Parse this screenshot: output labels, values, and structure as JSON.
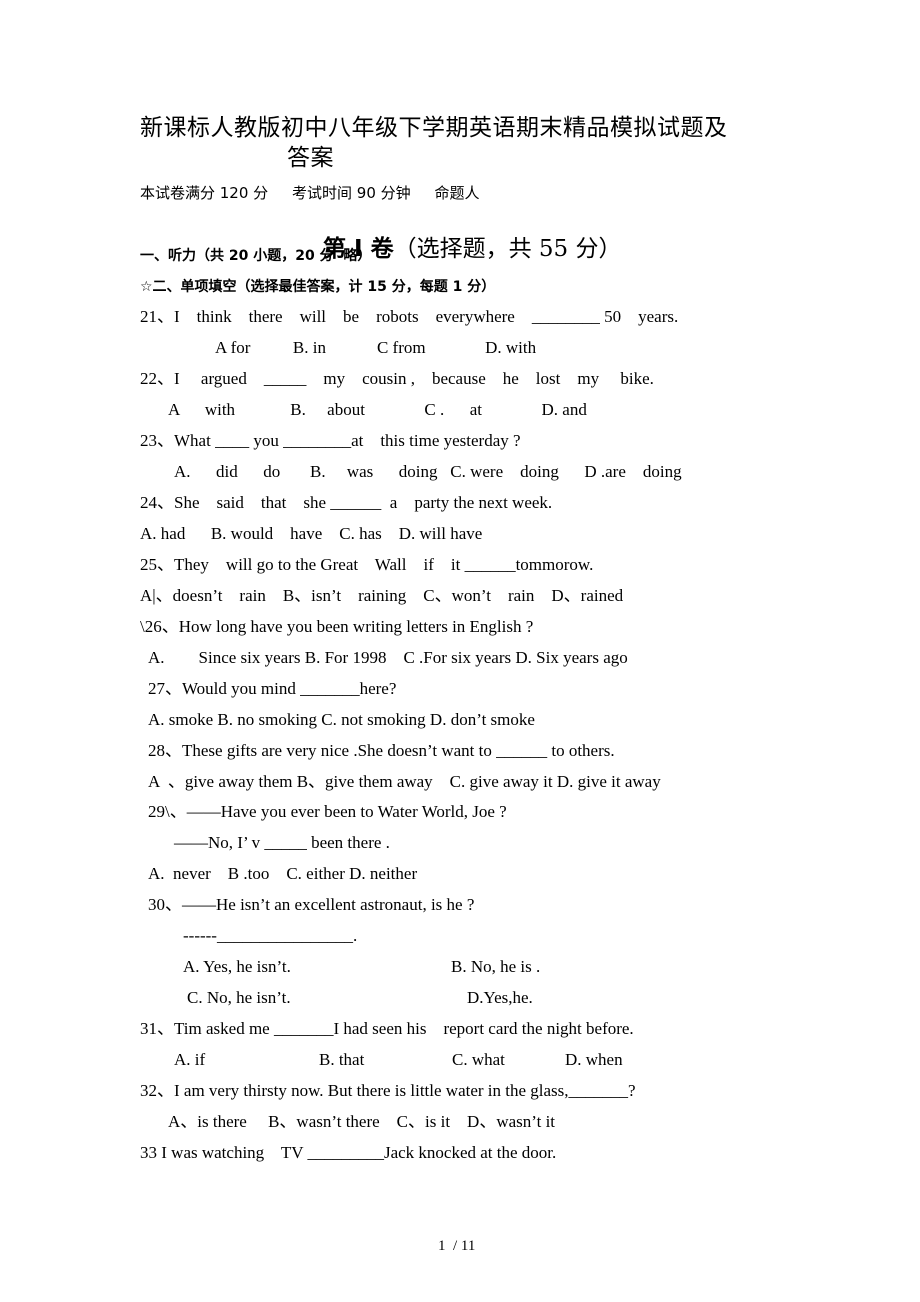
{
  "document": {
    "title_line1": "新课标人教版初中八年级下学期英语期末精品模拟试题及",
    "title_line2": "答案",
    "meta": "本试卷满分 120 分     考试时间 90 分钟     命题人",
    "part_bold": "第 I 卷",
    "part_rest": "（选择题，共 55 分）",
    "section1": "一、听力（共 20 小题，20 分  略）",
    "section2": "☆二、单项填空（选择最佳答案，计 15 分，每题 1 分）"
  },
  "lines": [
    "21、I    think    there    will    be    robots    everywhere    ________ 50    years.",
    "A for          B. in            C from              D. with",
    "22、I     argued    _____    my    cousin ,    because    he    lost    my     bike.",
    "A      with             B.     about              C .      at              D. and",
    "23、What ____ you ________at    this time yesterday ?",
    "A.      did      do       B.     was      doing   C. were    doing      D .are    doing",
    "24、She    said    that    she ______  a    party the next week.",
    "A. had      B. would    have    C. has    D. will have",
    "25、They    will go to the Great    Wall    if    it ______tommorow.",
    "A|、doesn’t    rain    B、isn’t    raining    C、won’t    rain    D、rained",
    "\\26、How long have you been writing letters in English ?",
    "A.        Since six years B. For 1998    C .For six years D. Six years ago",
    "27、Would you mind _______here?",
    "A. smoke B. no smoking C. not smoking D. don’t smoke",
    "28、These gifts are very nice .She doesn’t want to ______ to others.",
    "A  、give away them B、give them away    C. give away it D. give it away",
    "29\\、——Have you ever been to Water World, Joe ?",
    "——No, I’ v _____ been there .",
    "A.  never    B .too    C. either D. neither",
    "30、——He isn’t an excellent astronaut, is he ?",
    "------________________.",
    "A. Yes, he isn’t.",
    "B. No, he is .",
    "C. No, he isn’t.",
    "D.Yes,he.",
    "31、Tim asked me _______I had seen his    report card the night before.",
    "A. if",
    "B. that",
    "C. what",
    "D. when",
    "32、I am very thirsty now. But there is little water in the glass,_______?",
    "A、is there     B、wasn’t there    C、is it    D、wasn’t it",
    "33 I was watching    TV _________Jack knocked at the door."
  ],
  "footer": {
    "page_indicator": "1  / 11"
  }
}
